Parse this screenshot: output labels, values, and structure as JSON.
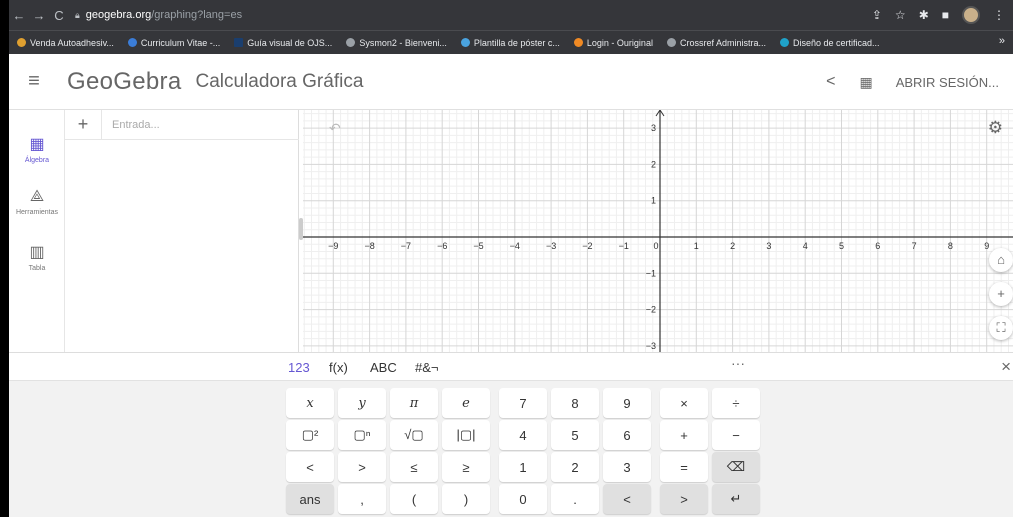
{
  "browser": {
    "url_host": "geogebra.org",
    "url_path": "/graphing?lang=es",
    "bookmarks": [
      {
        "label": "Venda Autoadhesiv...",
        "color": "#e0a030"
      },
      {
        "label": "Curriculum Vitae -...",
        "color": "#3b7dd8"
      },
      {
        "label": "Guía visual de OJS...",
        "color": "#1a3e6e"
      },
      {
        "label": "Sysmon2 - Bienveni...",
        "color": "#9aa0a6"
      },
      {
        "label": "Plantilla de póster c...",
        "color": "#4aa3df"
      },
      {
        "label": "Login - Ouriginal",
        "color": "#f08a24"
      },
      {
        "label": "Crossref Administra...",
        "color": "#9aa0a6"
      },
      {
        "label": "Diseño de certificad...",
        "color": "#1fa2c9"
      }
    ],
    "bookmarks_more": "»"
  },
  "header": {
    "menu_icon": "hamburger-icon",
    "logo": "GeoGebra",
    "title": "Calculadora Gráfica",
    "signin": "ABRIR SESIÓN..."
  },
  "sidebar": {
    "items": [
      {
        "label": "Álgebra",
        "icon": "calculator-icon",
        "active": true
      },
      {
        "label": "Herramientas",
        "icon": "tools-icon"
      },
      {
        "label": "Tabla",
        "icon": "table-icon"
      }
    ]
  },
  "algebra": {
    "input_placeholder": "Entrada...",
    "plus": "+"
  },
  "graph": {
    "x_ticks": [
      "-9",
      "-8",
      "-7",
      "-6",
      "-5",
      "-4",
      "-3",
      "-2",
      "-1",
      "0",
      "1",
      "2",
      "3",
      "4",
      "5",
      "6",
      "7",
      "8",
      "9"
    ],
    "y_ticks": [
      "3",
      "2",
      "1",
      "-1",
      "-2",
      "-3"
    ],
    "axis_color": "#333333",
    "grid_major": "#d6d6d6",
    "grid_minor": "#efefef"
  },
  "keyboard": {
    "tabs": [
      "123",
      "f(x)",
      "ABC",
      "#&¬"
    ],
    "more": "···",
    "close": "×",
    "rows": [
      [
        "x",
        "y",
        "π",
        "e",
        "7",
        "8",
        "9",
        "×",
        "÷"
      ],
      [
        "▢²",
        "▢ⁿ",
        "√▢",
        "|▢|",
        "4",
        "5",
        "6",
        "+",
        "−"
      ],
      [
        "<",
        ">",
        "≤",
        "≥",
        "1",
        "2",
        "3",
        "=",
        "⌫"
      ],
      [
        "ans",
        ",",
        "(",
        ")",
        "0",
        ".",
        "<",
        ">",
        "↵"
      ]
    ]
  }
}
